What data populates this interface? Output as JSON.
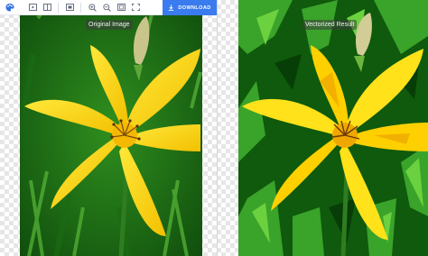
{
  "toolbar": {
    "logo_icon": "palette-icon",
    "buttons": [
      {
        "name": "rect-view-icon"
      },
      {
        "name": "split-view-icon"
      },
      {
        "name": "single-view-icon"
      },
      {
        "name": "zoom-in-icon"
      },
      {
        "name": "zoom-out-icon"
      },
      {
        "name": "fit-screen-icon"
      },
      {
        "name": "actual-size-icon"
      }
    ],
    "download_label": "DOWNLOAD",
    "accent_color": "#3a7bef"
  },
  "panels": {
    "original_label": "Original Image",
    "vectorized_label": "Vectorized Result"
  }
}
